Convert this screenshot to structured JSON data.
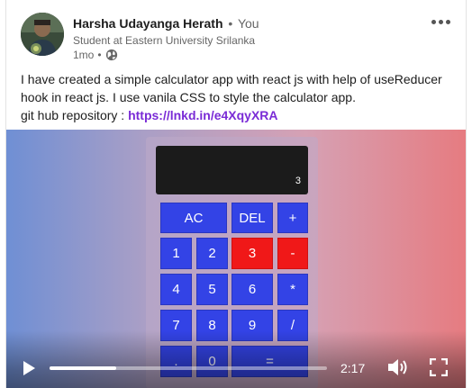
{
  "post": {
    "author": {
      "name": "Harsha Udayanga Herath",
      "separator": "•",
      "relation": "You",
      "headline": "Student at Eastern University Srilanka",
      "time": "1mo",
      "time_separator": "•",
      "visibility_icon": "globe-icon"
    },
    "more_icon": "more-horizontal-icon",
    "text": {
      "line1": "I have created a simple calculator app with react js with help of useReducer",
      "line2": "hook in react js. I use vanila CSS to style the calculator app.",
      "line3_prefix": "git hub repository : ",
      "link": "https://lnkd.in/e4XqyXRA"
    }
  },
  "video": {
    "calculator": {
      "display_value": "3",
      "keys": {
        "ac": "AC",
        "del": "DEL",
        "plus": "+",
        "one": "1",
        "two": "2",
        "three": "3",
        "minus": "-",
        "four": "4",
        "five": "5",
        "six": "6",
        "multiply": "*",
        "seven": "7",
        "eight": "8",
        "nine": "9",
        "divide": "/",
        "dot": ".",
        "zero": "0",
        "equals": "="
      },
      "active_key_color": "#f01818",
      "key_color": "#3343e6"
    },
    "controls": {
      "play_icon": "play-icon",
      "progress_fraction": 0.24,
      "time": "2:17",
      "volume_icon": "volume-icon",
      "fullscreen_icon": "fullscreen-icon"
    }
  }
}
